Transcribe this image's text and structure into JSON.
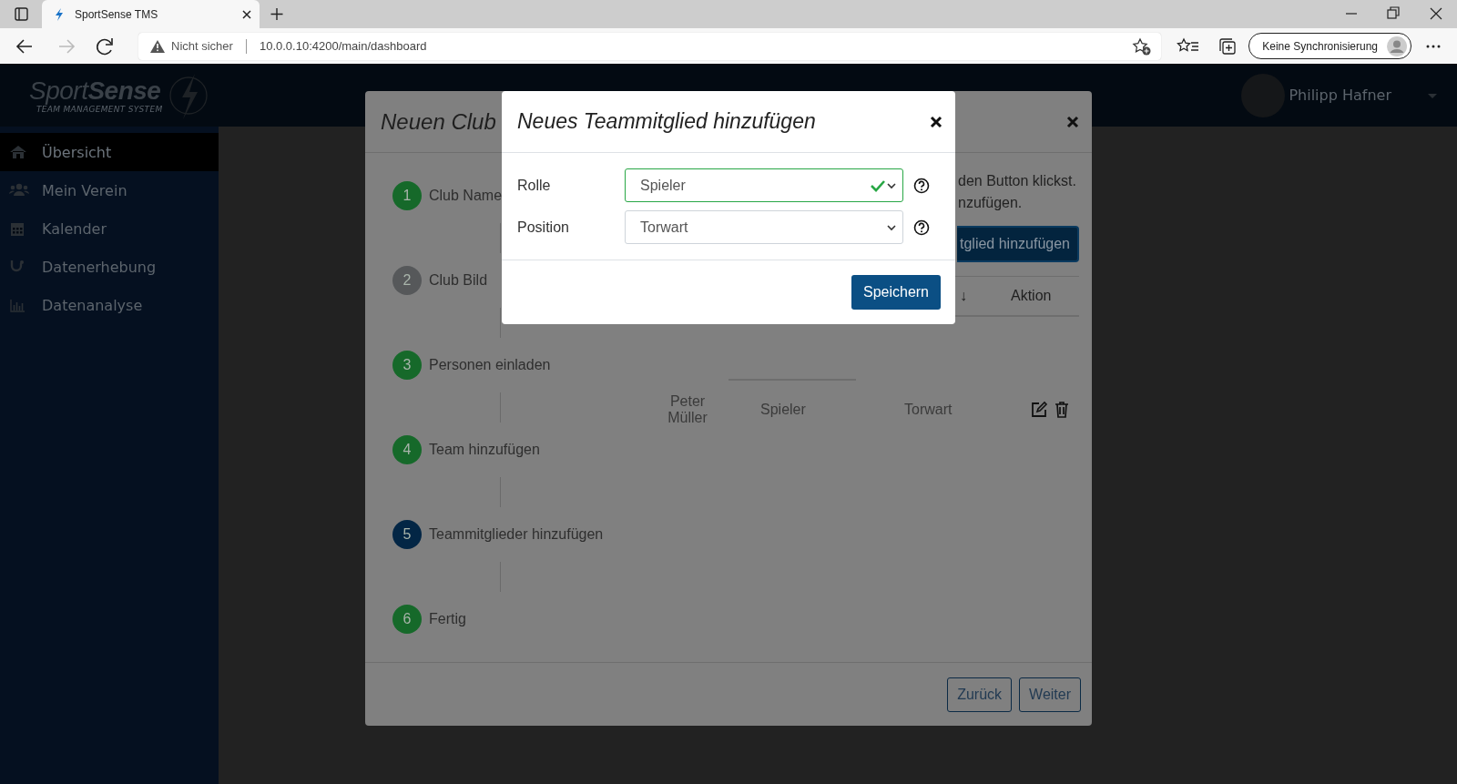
{
  "browser": {
    "tab_title": "SportSense TMS",
    "security_label": "Nicht sicher",
    "url": "10.0.0.10:4200/main/dashboard",
    "sync_label": "Keine Synchronisierung"
  },
  "app": {
    "logo_light": "Sport",
    "logo_bold": "Sense",
    "tagline": "TEAM MANAGEMENT SYSTEM",
    "user_name": "Philipp Hafner"
  },
  "sidebar": {
    "items": [
      {
        "label": "Übersicht",
        "kind": "home",
        "selected": true
      },
      {
        "label": "Mein Verein",
        "kind": "users",
        "selected": false
      },
      {
        "label": "Kalender",
        "kind": "calendar",
        "selected": false
      },
      {
        "label": "Datenerhebung",
        "kind": "stethoscope",
        "selected": false
      },
      {
        "label": "Datenanalyse",
        "kind": "chart",
        "selected": false
      }
    ]
  },
  "wizard": {
    "title": "Neuen Club",
    "steps": [
      {
        "number": "1",
        "label": "Club Name",
        "color": "#16692a"
      },
      {
        "number": "2",
        "label": "Club Bild",
        "color": "#56585a"
      },
      {
        "number": "3",
        "label": "Personen einladen",
        "color": "#16692a"
      },
      {
        "number": "4",
        "label": "Team hinzufügen",
        "color": "#16692a"
      },
      {
        "number": "5",
        "label": "Teammitglieder hinzufügen",
        "color": "#032645"
      },
      {
        "number": "6",
        "label": "Fertig",
        "color": "#16692a"
      }
    ],
    "hint_lines": [
      "den Button klickst.",
      "nzufügen."
    ],
    "add_button": "tglied hinzufügen",
    "table": {
      "header": [
        "↓",
        "Aktion"
      ],
      "rows": [
        {
          "cells": [
            "Peter Müller",
            "Spieler",
            "Torwart"
          ]
        }
      ]
    },
    "buttons": [
      "Zurück",
      "Weiter"
    ]
  },
  "dialog": {
    "title": "Neues Teammitglied hinzufügen",
    "fields": [
      {
        "label": "Rolle",
        "value": "Spieler",
        "valid": true
      },
      {
        "label": "Position",
        "value": "Torwart",
        "valid": false
      }
    ],
    "save_button": "Speichern"
  }
}
